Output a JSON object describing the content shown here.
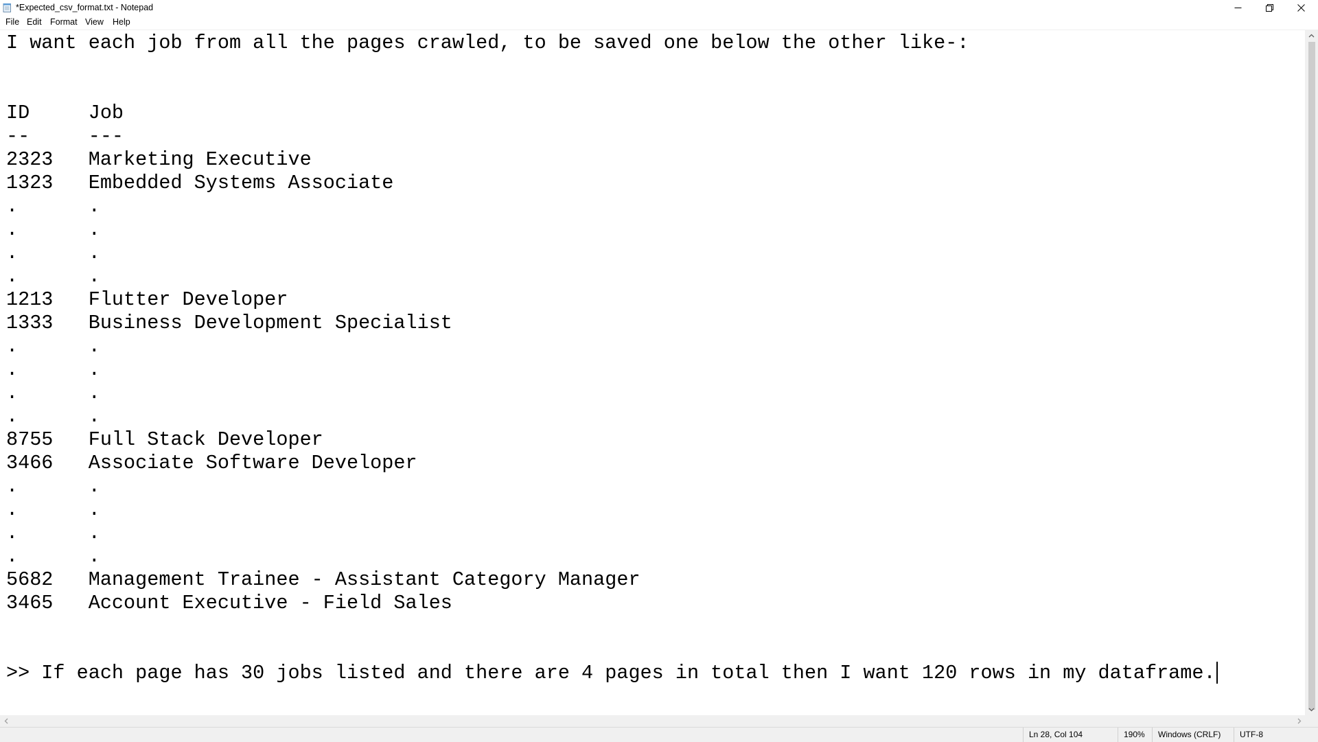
{
  "window": {
    "title": "*Expected_csv_format.txt - Notepad"
  },
  "menu": {
    "file": "File",
    "edit": "Edit",
    "format": "Format",
    "view": "View",
    "help": "Help"
  },
  "editor": {
    "lines": [
      "I want each job from all the pages crawled, to be saved one below the other like-:",
      "",
      "",
      "ID     Job",
      "--     ---",
      "2323   Marketing Executive",
      "1323   Embedded Systems Associate",
      ".      .",
      ".      .",
      ".      .",
      ".      .",
      "1213   Flutter Developer",
      "1333   Business Development Specialist",
      ".      .",
      ".      .",
      ".      .",
      ".      .",
      "8755   Full Stack Developer",
      "3466   Associate Software Developer",
      ".      .",
      ".      .",
      ".      .",
      ".      .",
      "5682   Management Trainee - Assistant Category Manager",
      "3465   Account Executive - Field Sales",
      "",
      "",
      ">> If each page has 30 jobs listed and there are 4 pages in total then I want 120 rows in my dataframe."
    ]
  },
  "status": {
    "position": "Ln 28, Col 104",
    "zoom": "190%",
    "line_ending": "Windows (CRLF)",
    "encoding": "UTF-8"
  },
  "icons": {
    "app": "notepad-icon",
    "minimize": "minimize-icon",
    "maximize": "restore-icon",
    "close": "close-icon"
  }
}
